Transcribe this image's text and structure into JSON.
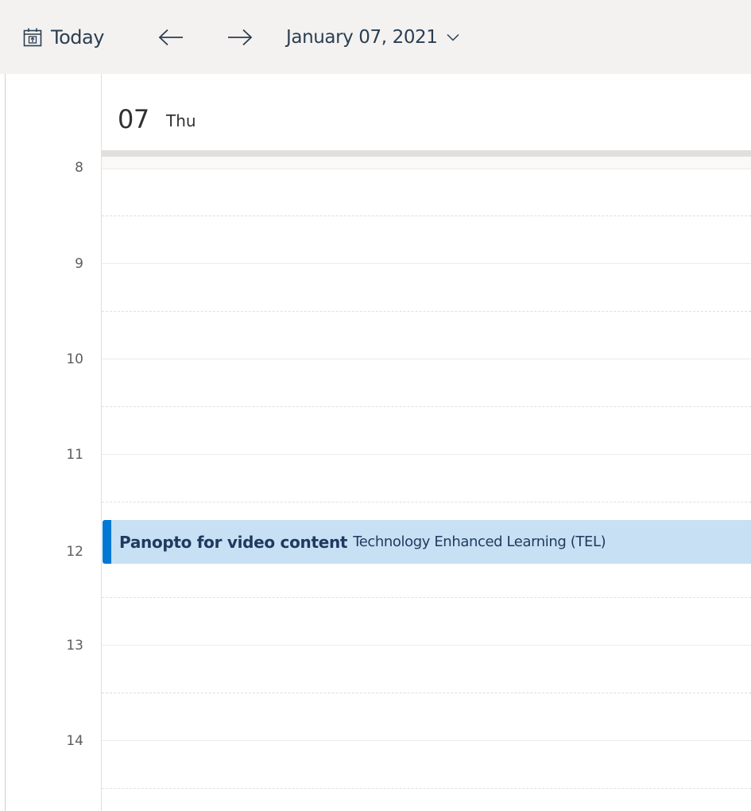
{
  "toolbar": {
    "today_label": "Today",
    "prev_icon": "arrow-left-icon",
    "next_icon": "arrow-right-icon",
    "date_label": "January 07, 2021",
    "date_icon": "chevron-down-icon",
    "today_icon": "calendar-today-icon"
  },
  "day_header": {
    "day_number": "07",
    "day_name": "Thu"
  },
  "hours": [
    "8",
    "9",
    "10",
    "11",
    "12",
    "13",
    "14"
  ],
  "event": {
    "title": "Panopto for video content",
    "organizer": "Technology Enhanced Learning (TEL)",
    "accent_color": "#0078d4",
    "background_color": "#c7e0f4"
  }
}
